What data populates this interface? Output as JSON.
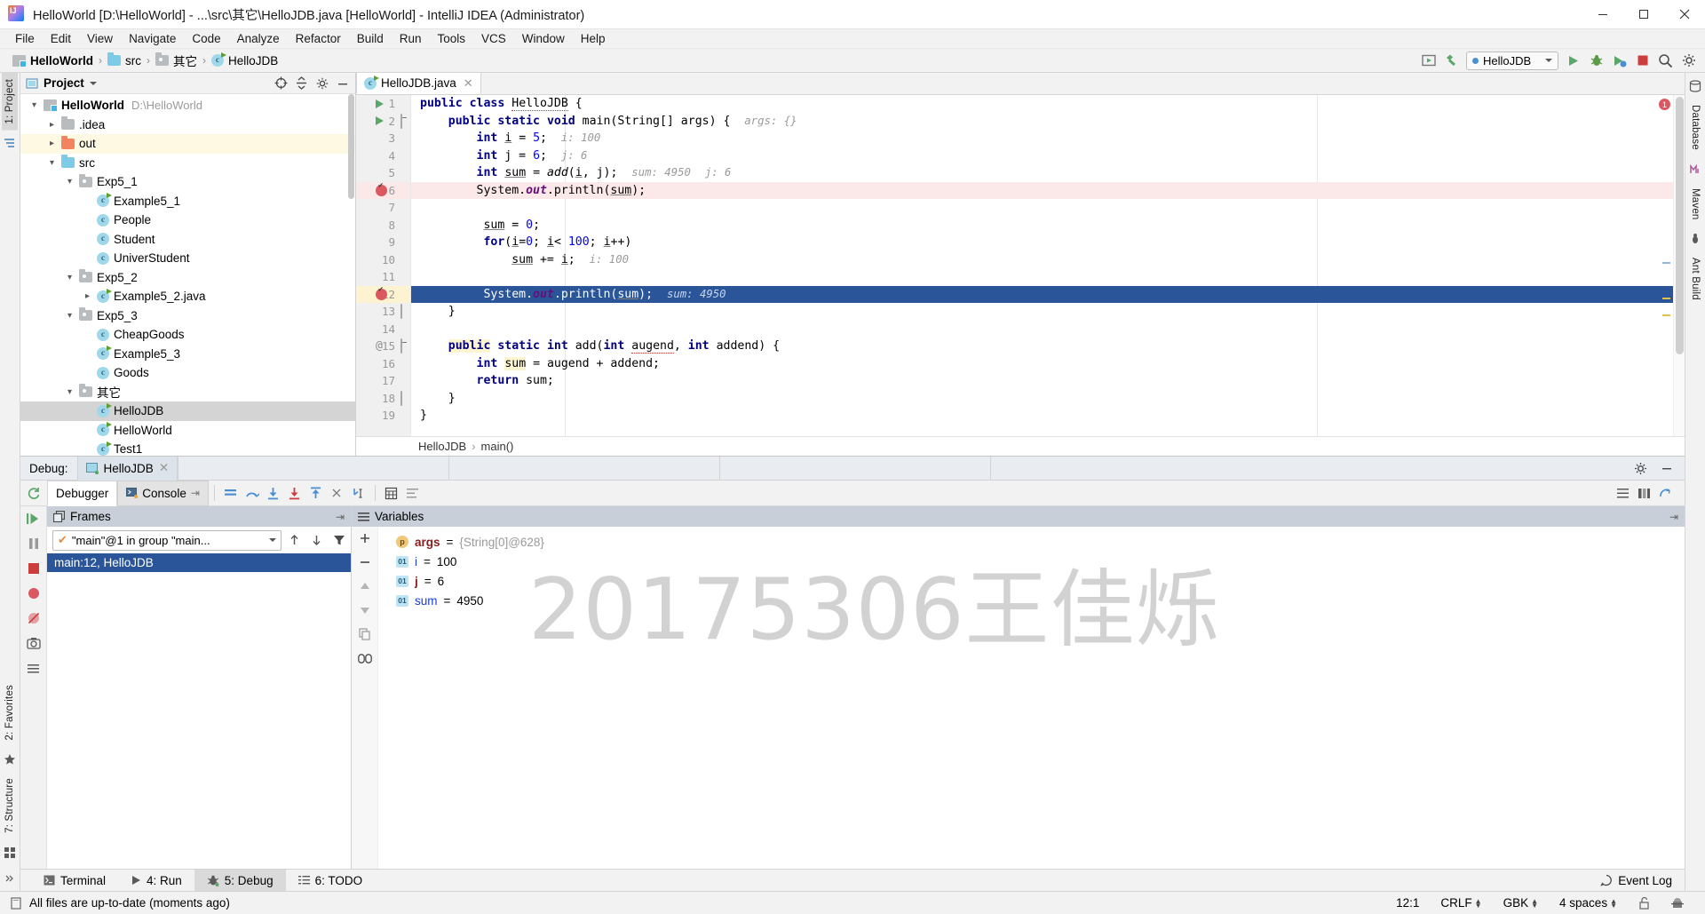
{
  "window": {
    "title": "HelloWorld [D:\\HelloWorld] - ...\\src\\其它\\HelloJDB.java [HelloWorld] - IntelliJ IDEA (Administrator)",
    "minimize": "—",
    "maximize": "▢",
    "close": "✕"
  },
  "menu": [
    {
      "label": "File"
    },
    {
      "label": "Edit"
    },
    {
      "label": "View"
    },
    {
      "label": "Navigate"
    },
    {
      "label": "Code"
    },
    {
      "label": "Analyze"
    },
    {
      "label": "Refactor"
    },
    {
      "label": "Build"
    },
    {
      "label": "Run"
    },
    {
      "label": "Tools"
    },
    {
      "label": "VCS"
    },
    {
      "label": "Window"
    },
    {
      "label": "Help"
    }
  ],
  "navbar": {
    "crumbs": [
      "HelloWorld",
      "src",
      "其它",
      "HelloJDB"
    ],
    "separator": "›",
    "run_config": "HelloJDB"
  },
  "left_rail": {
    "project_tab": "1: Project",
    "favorites_tab": "2: Favorites",
    "structure_tab": "7: Structure"
  },
  "right_rail": {
    "database_tab": "Database",
    "maven_tab": "Maven",
    "ant_tab": "Ant Build"
  },
  "project_panel": {
    "title": "Project",
    "tree": [
      {
        "label": "HelloWorld",
        "path": "D:\\HelloWorld",
        "icon": "module-icon",
        "indent": 0,
        "chevron": "down",
        "bold": true,
        "state": "normal"
      },
      {
        "label": ".idea",
        "path": "",
        "icon": "folder-gray",
        "indent": 1,
        "chevron": "right",
        "bold": false,
        "state": "normal"
      },
      {
        "label": "out",
        "path": "",
        "icon": "folder-orange",
        "indent": 1,
        "chevron": "right",
        "bold": false,
        "state": "highlight"
      },
      {
        "label": "src",
        "path": "",
        "icon": "folder-blue",
        "indent": 1,
        "chevron": "down",
        "bold": false,
        "state": "normal"
      },
      {
        "label": "Exp5_1",
        "path": "",
        "icon": "folder-pkg",
        "indent": 2,
        "chevron": "down",
        "bold": false,
        "state": "normal"
      },
      {
        "label": "Example5_1",
        "path": "",
        "icon": "class-runnable",
        "indent": 3,
        "chevron": "none",
        "bold": false,
        "state": "normal"
      },
      {
        "label": "People",
        "path": "",
        "icon": "class",
        "indent": 3,
        "chevron": "none",
        "bold": false,
        "state": "normal"
      },
      {
        "label": "Student",
        "path": "",
        "icon": "class",
        "indent": 3,
        "chevron": "none",
        "bold": false,
        "state": "normal"
      },
      {
        "label": "UniverStudent",
        "path": "",
        "icon": "class",
        "indent": 3,
        "chevron": "none",
        "bold": false,
        "state": "normal"
      },
      {
        "label": "Exp5_2",
        "path": "",
        "icon": "folder-pkg",
        "indent": 2,
        "chevron": "down",
        "bold": false,
        "state": "normal"
      },
      {
        "label": "Example5_2.java",
        "path": "",
        "icon": "class-runnable",
        "indent": 3,
        "chevron": "right",
        "bold": false,
        "state": "normal"
      },
      {
        "label": "Exp5_3",
        "path": "",
        "icon": "folder-pkg",
        "indent": 2,
        "chevron": "down",
        "bold": false,
        "state": "normal"
      },
      {
        "label": "CheapGoods",
        "path": "",
        "icon": "class",
        "indent": 3,
        "chevron": "none",
        "bold": false,
        "state": "normal"
      },
      {
        "label": "Example5_3",
        "path": "",
        "icon": "class-runnable",
        "indent": 3,
        "chevron": "none",
        "bold": false,
        "state": "normal"
      },
      {
        "label": "Goods",
        "path": "",
        "icon": "class",
        "indent": 3,
        "chevron": "none",
        "bold": false,
        "state": "normal"
      },
      {
        "label": "其它",
        "path": "",
        "icon": "folder-pkg",
        "indent": 2,
        "chevron": "down",
        "bold": false,
        "state": "normal"
      },
      {
        "label": "HelloJDB",
        "path": "",
        "icon": "class-runnable",
        "indent": 3,
        "chevron": "none",
        "bold": false,
        "state": "selected"
      },
      {
        "label": "HelloWorld",
        "path": "",
        "icon": "class-runnable",
        "indent": 3,
        "chevron": "none",
        "bold": false,
        "state": "normal"
      },
      {
        "label": "Test1",
        "path": "",
        "icon": "class-runnable",
        "indent": 3,
        "chevron": "none",
        "bold": false,
        "state": "normal"
      }
    ]
  },
  "editor": {
    "tab_label": "HelloJDB.java",
    "tab_close": "✕",
    "breadcrumb": [
      "HelloJDB",
      "main()"
    ],
    "breadcrumb_sep": "›",
    "lines": [
      {
        "n": 1,
        "marks": [
          "run"
        ],
        "fold": "",
        "highlight": "none"
      },
      {
        "n": 2,
        "marks": [
          "run"
        ],
        "fold": "down",
        "highlight": "none"
      },
      {
        "n": 3,
        "marks": [],
        "fold": "",
        "highlight": "none"
      },
      {
        "n": 4,
        "marks": [],
        "fold": "",
        "highlight": "none"
      },
      {
        "n": 5,
        "marks": [],
        "fold": "",
        "highlight": "none"
      },
      {
        "n": 6,
        "marks": [
          "bp"
        ],
        "fold": "",
        "highlight": "pink"
      },
      {
        "n": 7,
        "marks": [],
        "fold": "",
        "highlight": "none"
      },
      {
        "n": 8,
        "marks": [],
        "fold": "",
        "highlight": "none"
      },
      {
        "n": 9,
        "marks": [],
        "fold": "",
        "highlight": "none"
      },
      {
        "n": 10,
        "marks": [],
        "fold": "",
        "highlight": "none"
      },
      {
        "n": 11,
        "marks": [],
        "fold": "",
        "highlight": "none"
      },
      {
        "n": 12,
        "marks": [
          "bp"
        ],
        "fold": "",
        "highlight": "selected"
      },
      {
        "n": 13,
        "marks": [],
        "fold": "up",
        "highlight": "none"
      },
      {
        "n": 14,
        "marks": [],
        "fold": "",
        "highlight": "none"
      },
      {
        "n": 15,
        "marks": [
          "at"
        ],
        "fold": "down",
        "highlight": "none"
      },
      {
        "n": 16,
        "marks": [],
        "fold": "",
        "highlight": "none"
      },
      {
        "n": 17,
        "marks": [],
        "fold": "",
        "highlight": "none"
      },
      {
        "n": 18,
        "marks": [],
        "fold": "up",
        "highlight": "none"
      },
      {
        "n": 19,
        "marks": [],
        "fold": "",
        "highlight": "none"
      }
    ],
    "code_text": [
      "public class HelloJDB {",
      "    public static void main(String[] args) {   args: {}",
      "            int i = 5;   i: 100",
      "            int j = 6;   j: 6",
      "            int sum = add(i, j);   sum: 4950   j: 6",
      "            System. out.println(sum);",
      "",
      "             sum = 0;",
      "             for(i=0; i< 100; i++)",
      "                  sum += i;   i: 100",
      "",
      "             System. out.println(sum);   sum: 4950",
      "        }",
      "",
      "    public static int add(int augend, int addend) {",
      "        int sum = augend + addend;",
      "        return sum;",
      "    }",
      "}"
    ],
    "inlay_hints": {
      "args": "args: {}",
      "i_line3": "i: 100",
      "j_line4": "j: 6",
      "sum_line5": "sum: 4950",
      "j_line5": "j: 6",
      "i_line10": "i: 100",
      "sum_line12": "sum: 4950"
    },
    "error_count": "1"
  },
  "debug": {
    "header_label": "Debug:",
    "session_name": "HelloJDB",
    "session_close": "✕",
    "tabs": [
      {
        "label": "Debugger",
        "active": true
      },
      {
        "label": "Console",
        "active": false
      }
    ],
    "frames": {
      "title": "Frames",
      "thread": "\"main\"@1 in group \"main...",
      "selected_frame": "main:12, HelloJDB"
    },
    "variables": {
      "title": "Variables",
      "items": [
        {
          "icon": "p",
          "name": "args",
          "value": "{String[0]@628}",
          "value_style": "gray",
          "name_style": "red"
        },
        {
          "icon": "01",
          "name": "i",
          "value": "100",
          "value_style": "black",
          "name_style": "blue"
        },
        {
          "icon": "01",
          "name": "j",
          "value": "6",
          "value_style": "black",
          "name_style": "red"
        },
        {
          "icon": "01",
          "name": "sum",
          "value": "4950",
          "value_style": "black",
          "name_style": "blue"
        }
      ],
      "equals": "="
    }
  },
  "watermark": "20175306王佳烁",
  "bottom_tabs": [
    {
      "label": "Terminal",
      "accel": "",
      "active": false,
      "icon": "terminal-icon"
    },
    {
      "label": "4: Run",
      "accel": "4",
      "active": false,
      "icon": "run-icon"
    },
    {
      "label": "5: Debug",
      "accel": "5",
      "active": true,
      "icon": "debug-icon"
    },
    {
      "label": "6: TODO",
      "accel": "6",
      "active": false,
      "icon": "todo-icon"
    }
  ],
  "event_log": "Event Log",
  "statusbar": {
    "message": "All files are up-to-date (moments ago)",
    "caret": "12:1",
    "line_sep": "CRLF",
    "encoding": "GBK",
    "indent": "4 spaces"
  },
  "colors": {
    "accent_blue": "#2a5699",
    "breakpoint_red": "#db5860",
    "run_green": "#59a869",
    "highlight_yellow": "#fdf9e3",
    "selection_gray": "#d4d4d4"
  }
}
